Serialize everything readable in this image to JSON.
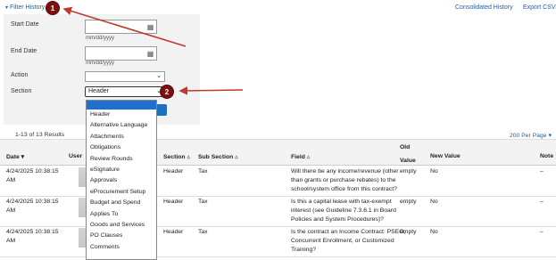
{
  "top": {
    "filter_history": "Filter History",
    "consolidated_history": "Consolidated History",
    "export_csv": "Export CSV"
  },
  "filters": {
    "start_date_label": "Start Date",
    "end_date_label": "End Date",
    "date_hint": "mm/dd/yyyy",
    "action_label": "Action",
    "action_value": "",
    "section_label": "Section",
    "section_value": "Header"
  },
  "section_options": [
    "Header",
    "Alternative Language",
    "Attachments",
    "Obligations",
    "Review Rounds",
    "eSignature",
    "Approvals",
    "eProcurement Setup",
    "Budget and Spend",
    "Applies To",
    "Goods and Services",
    "PO Clauses",
    "Comments"
  ],
  "results": {
    "count": "1-13 of 13 Results",
    "per_page": "200 Per Page"
  },
  "table": {
    "headers": {
      "date": "Date",
      "user": "User",
      "section": "Section",
      "subsection": "Sub Section",
      "field": "Field",
      "old_value_1": "Old",
      "old_value_2": "Value",
      "new_value": "New Value",
      "note": "Note"
    },
    "rows": [
      {
        "date_1": "4/24/2025 10:38:15",
        "date_2": "AM",
        "section": "Header",
        "subsection": "Tax",
        "field_1": "Will there be any income/revenue (other",
        "field_2": "than grants or purchase rebates) to the",
        "field_3": "school/system office from this contract?",
        "old": "empty",
        "new": "No",
        "note": "–"
      },
      {
        "date_1": "4/24/2025 10:38:15",
        "date_2": "AM",
        "section": "Header",
        "subsection": "Tax",
        "field_1": "Is this a capital lease with tax-exempt",
        "field_2": "interest (see Guideline 7.3.6.1 in Board",
        "field_3": "Policies and System Procedures)?",
        "old": "empty",
        "new": "No",
        "note": "–"
      },
      {
        "date_1": "4/24/2025 10:38:15",
        "date_2": "AM",
        "section": "Header",
        "subsection": "Tax",
        "field_1": "Is the contract an Income Contract: PSEO,",
        "field_2": "Concurrent Enrollment, or Customized",
        "field_3": "Training?",
        "old": "empty",
        "new": "No",
        "note": "–"
      }
    ]
  },
  "annotations": {
    "badge1": "1",
    "badge2": "2",
    "color": "#c0392b"
  }
}
